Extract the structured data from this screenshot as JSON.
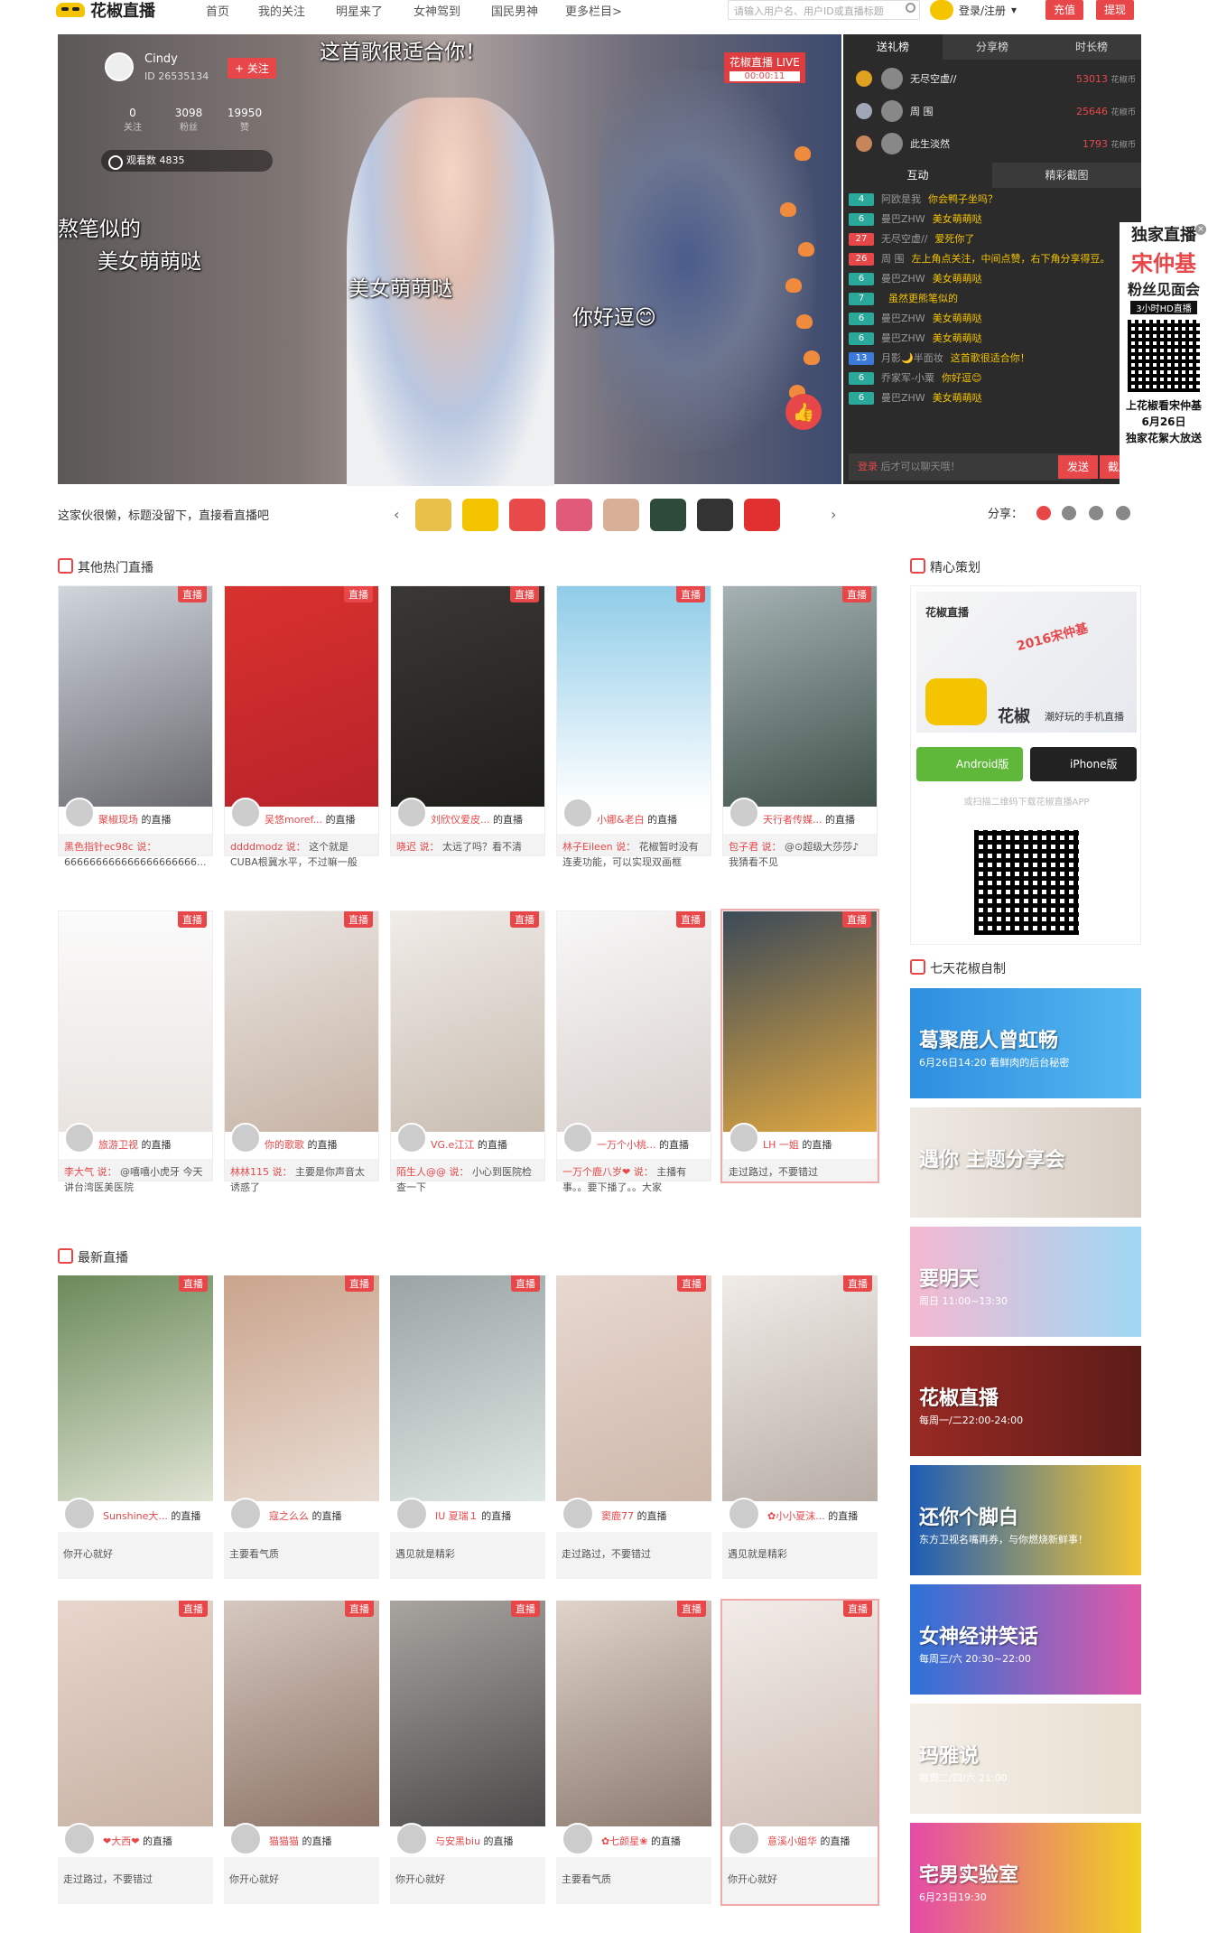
{
  "nav": {
    "logo_text": "花椒直播",
    "items": [
      "首页",
      "我的关注",
      "明星来了",
      "女神驾到",
      "国民男神",
      "更多栏目>"
    ],
    "search_placeholder": "请输入用户名、用户ID或直播标题",
    "login": "登录/注册",
    "recharge": "充值",
    "withdraw": "提现"
  },
  "host": {
    "name": "Cindy",
    "room_id": "ID 26535134",
    "follow": "+ 关注",
    "stats": [
      {
        "value": "0",
        "label": "关注"
      },
      {
        "value": "3098",
        "label": "粉丝"
      },
      {
        "value": "19950",
        "label": "赞"
      }
    ],
    "viewers": "观看数 4835"
  },
  "video": {
    "captions": [
      "这首歌很适合你！",
      "熬笔似的",
      "美女萌萌哒",
      "美女萌萌哒",
      "你好逗😊"
    ],
    "live_brand": "花椒直播 LIVE",
    "timer": "00:00:11"
  },
  "side": {
    "rank_tabs": [
      "送礼榜",
      "分享榜",
      "时长榜"
    ],
    "ranks": [
      {
        "name": "无尽空虚//",
        "value": "53013",
        "unit": "花椒币",
        "color": "#e0a020"
      },
      {
        "name": "周 围",
        "value": "25646",
        "unit": "花椒币",
        "color": "#a0a8b8"
      },
      {
        "name": "此生淡然",
        "value": "1793",
        "unit": "花椒币",
        "color": "#c7855a"
      }
    ],
    "chat_tabs": [
      "互动",
      "精彩截图"
    ],
    "chat": [
      {
        "lv": "4",
        "cls": "",
        "user": "阿欧是我",
        "text": "你会鸭子坐吗？"
      },
      {
        "lv": "6",
        "cls": "",
        "user": "曼巴ZHW",
        "text": "美女萌萌哒"
      },
      {
        "lv": "27",
        "cls": "red",
        "user": "无尽空虚//",
        "text": "爱死你了"
      },
      {
        "lv": "26",
        "cls": "red",
        "user": "周 围",
        "text": "左上角点关注，中间点赞，右下角分享得豆。"
      },
      {
        "lv": "6",
        "cls": "",
        "user": "曼巴ZHW",
        "text": "美女萌萌哒"
      },
      {
        "lv": "7",
        "cls": "",
        "user": "",
        "text": "虽然更熊笔似的"
      },
      {
        "lv": "6",
        "cls": "",
        "user": "曼巴ZHW",
        "text": "美女萌萌哒"
      },
      {
        "lv": "6",
        "cls": "",
        "user": "曼巴ZHW",
        "text": "美女萌萌哒"
      },
      {
        "lv": "13",
        "cls": "blue",
        "user": "月影🌙半面妆",
        "text": "这首歌很适合你！"
      },
      {
        "lv": "6",
        "cls": "",
        "user": "乔家军-小粟",
        "text": "你好逗😊"
      },
      {
        "lv": "6",
        "cls": "",
        "user": "曼巴ZHW",
        "text": "美女萌萌哒"
      }
    ],
    "chat_placeholder": "登录 后才可以聊天哦！",
    "login_word": "登录",
    "send": "发送",
    "screenshot": "截屏"
  },
  "promo": {
    "t1": "独家直播",
    "t2": "宋仲基",
    "t3": "粉丝见面会",
    "t4": "3小时HD直播",
    "t5": [
      "上花椒看宋仲基",
      "6月26日",
      "独家花絮大放送"
    ]
  },
  "infobar": {
    "desc": "这家伙很懒，标题没留下，直接看直播吧",
    "share": "分享：",
    "prev": "‹",
    "next": "›",
    "gifts": [
      "#e8c04a",
      "#f5c400",
      "#e84a4a",
      "#e05a7a",
      "#d8b098",
      "#2e4a3a",
      "#333",
      "#e03030"
    ]
  },
  "hot": {
    "title": "其他热门直播",
    "badge": "直播",
    "suffix": "的直播",
    "cards": [
      {
        "name": "聚椒现场",
        "say_name": "黑色指针ec98c 说：",
        "say": "666666666666666666666...",
        "bg": "linear-gradient(160deg,#cfd6dc,#6a6a70)"
      },
      {
        "name": "吴悠moref...",
        "say_name": "ddddmodz 说：",
        "say": "这个就是CUBA根冀水平，不过嘛一般",
        "bg": "linear-gradient(160deg,#d9322e,#b8232a)"
      },
      {
        "name": "刘欣仪爱皮...",
        "say_name": "晓迟 说：",
        "say": "太远了吗？看不清",
        "bg": "linear-gradient(160deg,#3a3834,#1e1d1a)"
      },
      {
        "name": "小娜&老白",
        "say_name": "林子Eileen 说：",
        "say": "花椒暂时没有连麦功能，可以实现双画框",
        "bg": "linear-gradient(180deg,#8fcce8,#ffffff)"
      },
      {
        "name": "天行者传媒...",
        "say_name": "包子君 说：",
        "say": "@⊙超级大莎莎♪ 我猜看不见",
        "bg": "linear-gradient(160deg,#a6b2b4,#40524a)"
      },
      {
        "name": "旅游卫视",
        "say_name": "李大气 说：",
        "say": "@嘻嘻小虎牙 今天讲台湾医美医院",
        "bg": "linear-gradient(180deg,#fbfbfb,#e9e4e0)"
      },
      {
        "name": "你的歌歌",
        "say_name": "林林115 说：",
        "say": "主要是你声音太诱惑了",
        "bg": "linear-gradient(160deg,#eae6e2,#c6b2a4)"
      },
      {
        "name": "VG.e江江",
        "say_name": "陌生人@@ 说：",
        "say": "小心到医院检查一下",
        "bg": "linear-gradient(160deg,#f0ece8,#c8bcb0)"
      },
      {
        "name": "一万个小桃...",
        "say_name": "一万个鹿八岁❤ 说：",
        "say": "主播有事。。要下播了。。大家",
        "bg": "linear-gradient(160deg,#f8f8f8,#d8d0cc)"
      },
      {
        "name": "LH 一姐",
        "say_name": "",
        "say": "走过路过，不要错过",
        "bg": "linear-gradient(160deg,#3c4a58,#e0a840)"
      }
    ]
  },
  "newest": {
    "title": "最新直播",
    "badge": "直播",
    "suffix": "的直播",
    "cards": [
      {
        "name": "Sunshine大...",
        "say": "你开心就好",
        "bg": "linear-gradient(160deg,#6c8a5a,#dfe4d4)"
      },
      {
        "name": "寇之么么",
        "say": "主要看气质",
        "bg": "linear-gradient(160deg,#caa48c,#e8ddd4)"
      },
      {
        "name": "IU 夏瑞１",
        "say": "遇见就是精彩",
        "bg": "linear-gradient(160deg,#9aa4a4,#dfe8e4)"
      },
      {
        "name": "窦鹿77",
        "say": "走过路过，不要错过",
        "bg": "linear-gradient(160deg,#e8d8d0,#cdb8aa)"
      },
      {
        "name": "✿小小夏沫...",
        "say": "遇见就是精彩",
        "bg": "linear-gradient(160deg,#f0ece8,#b8ada6)"
      },
      {
        "name": "❤大西❤",
        "say": "走过路过，不要错过",
        "bg": "linear-gradient(160deg,#e8d6cc,#c7b2a4)"
      },
      {
        "name": "猫猫猫",
        "say": "你开心就好",
        "bg": "linear-gradient(160deg,#d6c8c0,#8c7466)"
      },
      {
        "name": "与安黑biu",
        "say": "你开心就好",
        "bg": "linear-gradient(160deg,#a8a4a0,#4c4a4a)"
      },
      {
        "name": "✿七颜星❀",
        "say": "主要看气质",
        "bg": "linear-gradient(160deg,#e0d4ca,#8c7a70)"
      },
      {
        "name": "意溪小姐华",
        "say": "你开心就好",
        "bg": "linear-gradient(160deg,#f2ece8,#cfbfb6)"
      }
    ]
  },
  "feature": {
    "title": "精心策划",
    "b1": "花椒直播",
    "b2": "2016宋仲基",
    "b3": "花椒",
    "b4": "潮好玩的手机直播",
    "android": "Android版",
    "iphone": "iPhone版",
    "tip": "或扫描二维码下载花椒直播APP"
  },
  "weekly": {
    "title": "七天花椒自制",
    "ads": [
      {
        "a1": "葛聚鹿人曾虹畅",
        "a2": "6月26日14:20 看鲜肉的后台秘密",
        "bg": "linear-gradient(90deg,#2e8ee0,#56b8f0)"
      },
      {
        "a1": "遇你 主题分享会",
        "a2": "",
        "bg": "linear-gradient(90deg,#efeae4,#d6ccc2)"
      },
      {
        "a1": "要明天",
        "a2": "周日 11:00~13:30",
        "bg": "linear-gradient(90deg,#f5b8d0,#9ed8f5)"
      },
      {
        "a1": "花椒直播",
        "a2": "每周一/二22:00-24:00",
        "bg": "linear-gradient(90deg,#9a2a24,#5c1c18)"
      },
      {
        "a1": "还你个脚白",
        "a2": "东方卫视名嘴再券，与你燃烧新鲜事！",
        "bg": "linear-gradient(90deg,#1c5cb8,#f4c530)"
      },
      {
        "a1": "女神经讲笑话",
        "a2": "每周三/六 20:30~22:00",
        "bg": "linear-gradient(90deg,#2c72d8,#e058a8)"
      },
      {
        "a1": "玛雅说",
        "a2": "每周二/四/六 21:00",
        "bg": "linear-gradient(90deg,#f4efe8,#e8dfd0)"
      },
      {
        "a1": "宅男实验室",
        "a2": "6月23日19:30",
        "bg": "linear-gradient(90deg,#e44aa8,#f0d020)"
      }
    ]
  }
}
